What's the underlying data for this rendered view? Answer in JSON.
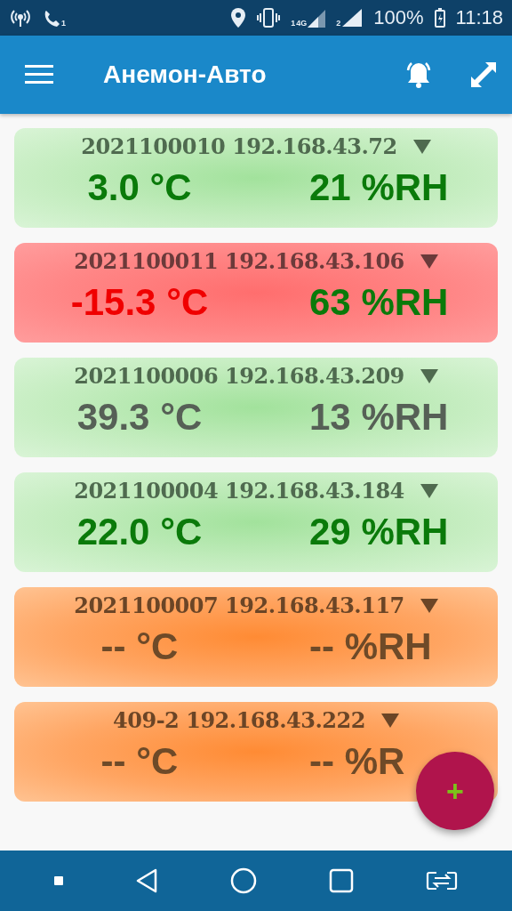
{
  "status_bar": {
    "call_sim": "1",
    "sim1_network": "4G",
    "sim1": "1",
    "sim2": "2",
    "battery": "100%",
    "time": "11:18"
  },
  "app_bar": {
    "title": "Анемон-Авто"
  },
  "sensors": [
    {
      "kind": "normal",
      "header": "2021100010 192.168.43.72",
      "expanded": false,
      "temperature": {
        "text": "3.0 °C",
        "color": "#0a7a0a"
      },
      "humidity": {
        "text": "21 %RH",
        "color": "#0a7a0a"
      }
    },
    {
      "kind": "alarm",
      "header": "2021100011 192.168.43.106",
      "expanded": false,
      "temperature": {
        "text": "-15.3 °C",
        "color": "#f00000"
      },
      "humidity": {
        "text": "63 %RH",
        "color": "#0a7a0a"
      }
    },
    {
      "kind": "normal",
      "header": "2021100006 192.168.43.209",
      "expanded": false,
      "temperature": {
        "text": "39.3 °C",
        "color": "#566056"
      },
      "humidity": {
        "text": "13 %RH",
        "color": "#566056"
      }
    },
    {
      "kind": "normal",
      "header": "2021100004 192.168.43.184",
      "expanded": false,
      "temperature": {
        "text": "22.0 °C",
        "color": "#0a7a0a"
      },
      "humidity": {
        "text": "29 %RH",
        "color": "#0a7a0a"
      }
    },
    {
      "kind": "offline",
      "header": "2021100007 192.168.43.117",
      "expanded": false,
      "temperature": {
        "text": "-- °C",
        "color": "#6e4a28"
      },
      "humidity": {
        "text": "-- %RH",
        "color": "#6e4a28"
      }
    },
    {
      "kind": "offline",
      "header": "409-2 192.168.43.222",
      "expanded": false,
      "temperature": {
        "text": "-- °C",
        "color": "#6e4a28"
      },
      "humidity": {
        "text": "-- %R",
        "color": "#6e4a28"
      }
    }
  ],
  "fab": {
    "label": "+"
  }
}
